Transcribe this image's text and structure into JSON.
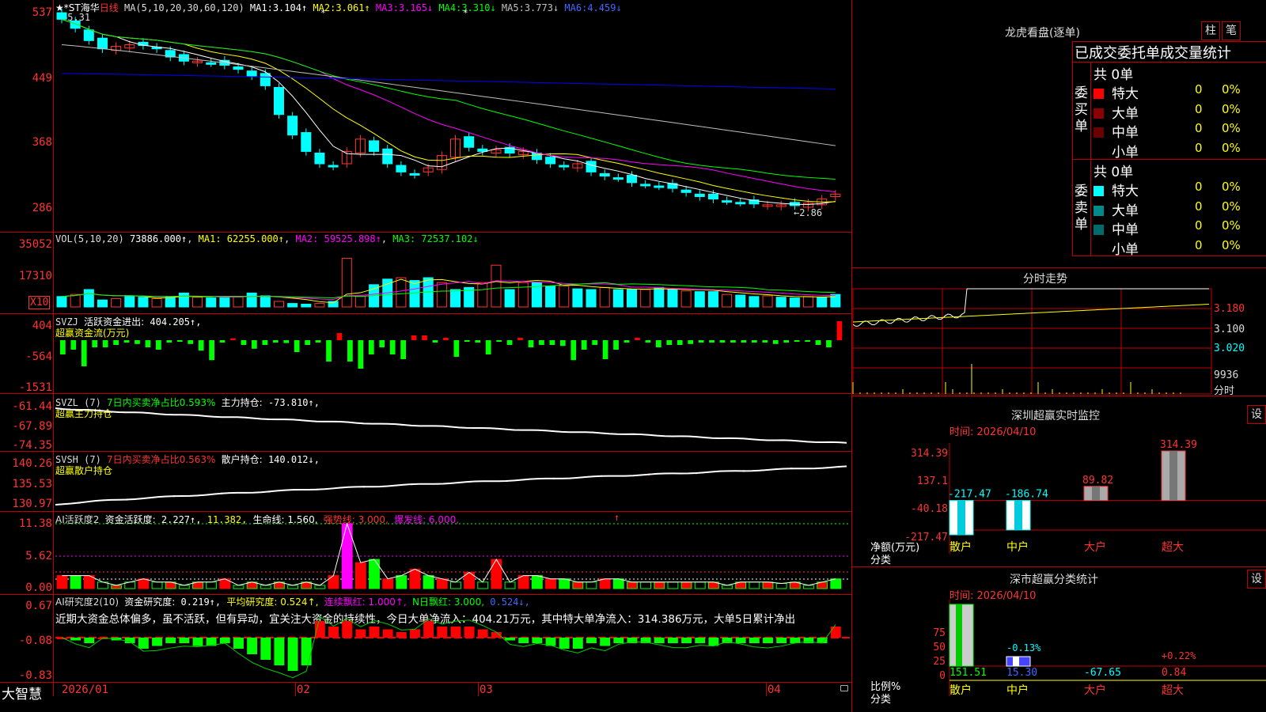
{
  "colors": {
    "up": "#ff3333",
    "down": "#00ffff",
    "ma1": "#ffffff",
    "ma2": "#ffff00",
    "ma3": "#ff00ff",
    "ma4": "#00ff00",
    "ma5": "#c0c0c0",
    "ma6": "#0000ff",
    "panel_border": "#c00000"
  },
  "main": {
    "title_symbol": "★*ST海华",
    "title_period": "日线",
    "ma_label": "MA(5,10,20,30,60,120)",
    "ma": [
      {
        "name": "MA1:",
        "value": "3.104↑"
      },
      {
        "name": "MA2:",
        "value": "3.061↑"
      },
      {
        "name": "MA3:",
        "value": "3.165↓"
      },
      {
        "name": "MA4:",
        "value": "3.310↓"
      },
      {
        "name": "MA5:",
        "value": "3.773↓"
      },
      {
        "name": "MA6:",
        "value": "4.459↓"
      }
    ],
    "high_marker": "←5.31",
    "low_marker": "←2.86",
    "axis": [
      "537",
      "449",
      "368",
      "286"
    ],
    "candles": [
      5.31,
      5.2,
      5.05,
      4.95,
      4.98,
      5.0,
      4.99,
      4.95,
      4.85,
      4.8,
      4.8,
      4.78,
      4.75,
      4.7,
      4.62,
      4.5,
      4.15,
      3.9,
      3.7,
      3.55,
      3.52,
      3.7,
      3.85,
      3.7,
      3.55,
      3.45,
      3.42,
      3.5,
      3.65,
      3.85,
      3.75,
      3.7,
      3.72,
      3.68,
      3.7,
      3.6,
      3.55,
      3.52,
      3.55,
      3.45,
      3.4,
      3.38,
      3.32,
      3.3,
      3.28,
      3.25,
      3.2,
      3.15,
      3.12,
      3.1,
      3.08,
      3.06,
      3.05,
      3.05,
      3.04,
      3.07,
      3.12,
      3.18
    ]
  },
  "vol": {
    "label": "VOL(5,10,20)",
    "value": "73886.000↑",
    "ma1": "MA1: 62255.000↑",
    "ma2": "MA2: 59525.898↑",
    "ma3": "MA3: 72537.102↓",
    "axis": [
      "35052",
      "17310"
    ],
    "unit": "X10",
    "bars": [
      0.15,
      0.18,
      0.25,
      0.1,
      0.12,
      0.16,
      0.14,
      0.12,
      0.14,
      0.2,
      0.14,
      0.13,
      0.14,
      0.14,
      0.2,
      0.16,
      0.08,
      0.05,
      0.04,
      0.05,
      0.08,
      0.7,
      0.15,
      0.32,
      0.4,
      0.42,
      0.38,
      0.42,
      0.35,
      0.25,
      0.28,
      0.35,
      0.6,
      0.25,
      0.35,
      0.35,
      0.3,
      0.3,
      0.26,
      0.25,
      0.28,
      0.25,
      0.25,
      0.25,
      0.28,
      0.25,
      0.23,
      0.22,
      0.22,
      0.18,
      0.17,
      0.15,
      0.16,
      0.14,
      0.13,
      0.15,
      0.14,
      0.18
    ]
  },
  "svzj": {
    "label": "SVZJ",
    "name": "活跃资金进出:",
    "value": "404.205↑,",
    "sub": "超赢资金流(万元)",
    "axis": [
      "404",
      "-564",
      "-1531"
    ],
    "bars": [
      -0.3,
      -0.2,
      -0.55,
      -0.15,
      -0.15,
      -0.1,
      -0.05,
      -0.08,
      -0.15,
      -0.2,
      -0.05,
      -0.02,
      -0.08,
      -0.22,
      -0.42,
      -0.05,
      0.04,
      -0.1,
      -0.18,
      -0.1,
      -0.05,
      -0.06,
      -0.25,
      -0.1,
      -0.05,
      -0.45,
      0.15,
      -0.45,
      -0.6,
      -0.3,
      -0.15,
      -0.3,
      -0.4,
      0.1,
      0.1,
      -0.05,
      0.05,
      -0.35,
      -0.03,
      -0.05,
      -0.3,
      -0.03,
      -0.1,
      0.05,
      -0.15,
      -0.1,
      -0.1,
      -0.12,
      -0.42,
      -0.2,
      -0.1,
      -0.4,
      -0.2,
      -0.05,
      0.05,
      -0.05,
      -0.15,
      -0.1,
      -0.1,
      -0.08,
      -0.05,
      -0.05,
      -0.05,
      -0.05,
      -0.05,
      -0.05,
      -0.05,
      -0.08,
      -0.05,
      -0.03,
      -0.02,
      -0.1,
      -0.15,
      0.4
    ]
  },
  "svzl": {
    "label": "SVZL (7)",
    "desc": "7日内买卖净占比0.593%",
    "name": "主力持仓:",
    "value": "-73.810↑,",
    "sub": "超赢主力持仓",
    "axis": [
      "-61.44",
      "-67.89",
      "-74.35"
    ]
  },
  "svsh": {
    "label": "SVSH (7)",
    "desc": "7日内买卖净占比0.563%",
    "name": "散户持仓:",
    "value": "140.012↓,",
    "sub": "超赢散户持仓",
    "axis": [
      "140.26",
      "135.53",
      "130.97"
    ]
  },
  "ai_active": {
    "label": "AI活跃度2",
    "name": "资金活跃度:",
    "value": "2.227↑,",
    "v2": "11.382,",
    "life": "生命线: 1.560,",
    "strong": "强势线: 3.000,",
    "burst": "爆发线: 6.000,",
    "axis": [
      "11.38",
      "5.62",
      "0.00"
    ],
    "bars": [
      0.2,
      0.2,
      0.2,
      0.1,
      0.05,
      0.1,
      0.15,
      0.1,
      0.1,
      0.05,
      0.1,
      0.1,
      0.15,
      0.05,
      0.1,
      0.05,
      0.1,
      0.05,
      0.1,
      0.05,
      0.2,
      1.0,
      0.4,
      0.45,
      0.15,
      0.2,
      0.3,
      0.2,
      0.15,
      0.1,
      0.25,
      0.1,
      0.45,
      0.1,
      0.2,
      0.2,
      0.15,
      0.15,
      0.1,
      0.1,
      0.15,
      0.15,
      0.1,
      0.1,
      0.1,
      0.1,
      0.1,
      0.1,
      0.1,
      0.05,
      0.1,
      0.1,
      0.1,
      0.08,
      0.1,
      0.05,
      0.1,
      0.15
    ]
  },
  "ai_research": {
    "label": "AI研究度2(10)",
    "name": "资金研究度:",
    "value": "0.219↑,",
    "avg": "平均研究度: 0.524↑,",
    "cont": "连续飘红: 1.000↑,",
    "nred": "N日飘红: 3.000,",
    "last": "0.524↓,",
    "axis": [
      "0.67",
      "-0.08",
      "-0.83"
    ],
    "comment": "近期大资金总体偏多，虽不活跃，但有异动，宜关注大资金的持续性，今日大单净流入：404.21万元，其中特大单净流入：314.386万元，大单5日累计净出",
    "bars": [
      0.0,
      -0.05,
      -0.1,
      0.0,
      -0.05,
      -0.1,
      -0.2,
      -0.15,
      -0.1,
      -0.1,
      -0.15,
      -0.15,
      -0.1,
      -0.2,
      -0.3,
      -0.4,
      -0.5,
      -0.6,
      -0.5,
      0.3,
      0.2,
      0.3,
      0.15,
      0.2,
      0.15,
      0.1,
      0.15,
      0.3,
      0.2,
      0.2,
      0.2,
      0.15,
      0.1,
      -0.05,
      -0.1,
      -0.1,
      -0.15,
      -0.2,
      -0.2,
      -0.1,
      -0.15,
      -0.1,
      -0.1,
      -0.1,
      -0.1,
      -0.1,
      -0.1,
      -0.1,
      -0.15,
      -0.1,
      -0.1,
      -0.1,
      -0.1,
      -0.1,
      -0.1,
      -0.1,
      -0.1,
      0.2
    ]
  },
  "xaxis": [
    "2026/01",
    "02",
    "03",
    "04"
  ],
  "bottom_left": "大智慧",
  "right": {
    "lhk_title": "龙虎看盘(逐单)",
    "btn_zhu": "柱",
    "btn_bi": "笔",
    "table_title": "已成交委托单成交量统计",
    "buy_label": "委买单",
    "sell_label": "委卖单",
    "buy_total": "共 0单",
    "sell_total": "共 0单",
    "buy_rows": [
      {
        "name": "特大",
        "n": "0",
        "p": "0%",
        "color": "#ff0000"
      },
      {
        "name": "大单",
        "n": "0",
        "p": "0%",
        "color": "#8b0000"
      },
      {
        "name": "中单",
        "n": "0",
        "p": "0%",
        "color": "#6b0000"
      },
      {
        "name": "小单",
        "n": "0",
        "p": "0%",
        "color": ""
      }
    ],
    "sell_rows": [
      {
        "name": "特大",
        "n": "0",
        "p": "0%",
        "color": "#00ffff"
      },
      {
        "name": "大单",
        "n": "0",
        "p": "0%",
        "color": "#008b8b"
      },
      {
        "name": "中单",
        "n": "0",
        "p": "0%",
        "color": "#006b6b"
      },
      {
        "name": "小单",
        "n": "0",
        "p": "0%",
        "color": ""
      }
    ],
    "fs_title": "分时走势",
    "fs_axis": [
      "3.180",
      "3.100",
      "3.020",
      "9936",
      "分时"
    ],
    "sz_title": "深圳超赢实时监控",
    "sz_btn": "设",
    "sz_time": "时间: 2026/04/10",
    "sz_axis": [
      "314.39",
      "137.1",
      "-40.18",
      "-217.47"
    ],
    "sz_ylabel": "净额(万元)",
    "sz_xlabel": "分类",
    "sz_values": [
      "-217.47",
      "-186.74",
      "89.82",
      "314.39"
    ],
    "sz_nums": [
      -217.47,
      -186.74,
      89.82,
      314.39
    ],
    "sz_cats": [
      "散户",
      "中户",
      "大户",
      "超大"
    ],
    "cls_title": "深市超赢分类统计",
    "cls_btn": "设",
    "cls_time": "时间: 2026/04/10",
    "cls_axis": [
      "75",
      "50",
      "25",
      "0"
    ],
    "cls_ylabel": "比例%",
    "cls_xlabel": "分类",
    "cls_pcts": [
      "",
      "-0.13%",
      "",
      "+0.22%"
    ],
    "cls_values": [
      "151.51",
      "15.30",
      "-67.65",
      "0.84"
    ],
    "cls_cats": [
      "散户",
      "中户",
      "大户",
      "超大"
    ]
  }
}
